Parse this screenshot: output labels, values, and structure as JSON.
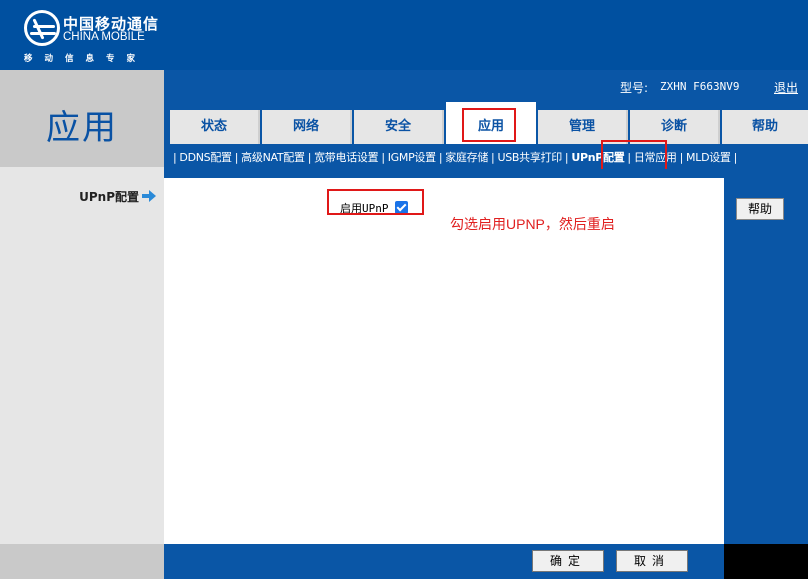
{
  "brand": {
    "cn": "中国移动通信",
    "en": "CHINA MOBILE",
    "sub": "移动信息专家"
  },
  "app_title": "应用",
  "model": {
    "label": "型号:",
    "value": "ZXHN F663NV9",
    "logout": "退出"
  },
  "tabs": [
    {
      "label": "状态"
    },
    {
      "label": "网络"
    },
    {
      "label": "安全"
    },
    {
      "label": "应用"
    },
    {
      "label": "管理"
    },
    {
      "label": "诊断"
    },
    {
      "label": "帮助"
    }
  ],
  "sub_nav": [
    {
      "label": "DDNS配置"
    },
    {
      "label": "高级NAT配置"
    },
    {
      "label": "宽带电话设置"
    },
    {
      "label": "IGMP设置"
    },
    {
      "label": "家庭存储"
    },
    {
      "label": "USB共享打印"
    },
    {
      "label": "UPnP配置"
    },
    {
      "label": "日常应用"
    },
    {
      "label": "MLD设置"
    }
  ],
  "section": {
    "label": "UPnP配置"
  },
  "form": {
    "upnp_label": "启用UPnP",
    "upnp_enabled": true
  },
  "annotation": "勾选启用UPNP，然后重启",
  "buttons": {
    "help": "帮助",
    "confirm": "确定",
    "cancel": "取消"
  },
  "colors": {
    "primary_blue": "#0a56a6",
    "highlight_red": "#e01818",
    "annotation_red": "#e02020"
  }
}
